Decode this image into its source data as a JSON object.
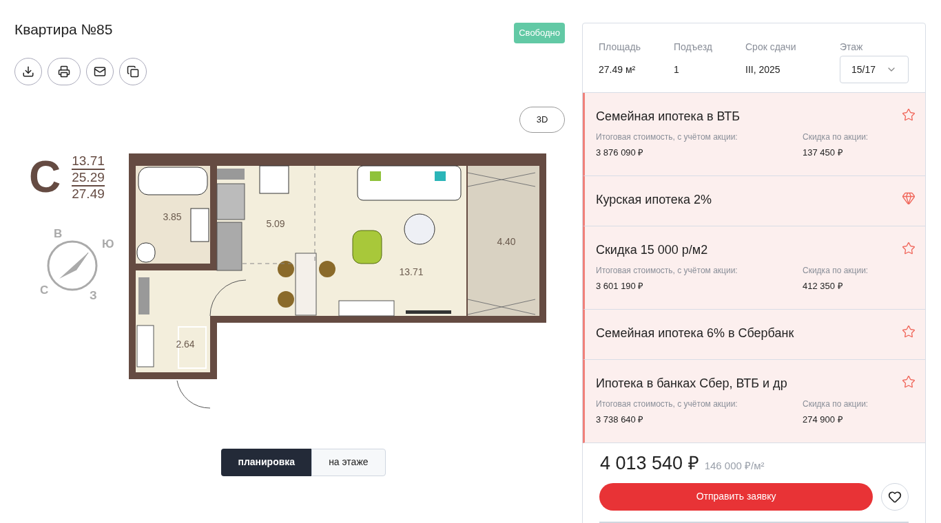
{
  "apartment": {
    "title": "Квартира №85",
    "status": "Свободно"
  },
  "view_3d_button": "3D",
  "legend": {
    "letter": "С",
    "areas": [
      "13.71",
      "25.29",
      "27.49"
    ]
  },
  "compass": {
    "labels": [
      "В",
      "Ю",
      "С",
      "З"
    ]
  },
  "plan": {
    "rooms": [
      {
        "label": "3.85"
      },
      {
        "label": "5.09"
      },
      {
        "label": "13.71"
      },
      {
        "label": "4.40"
      },
      {
        "label": "2.64"
      }
    ]
  },
  "view_tabs": [
    {
      "label": "планировка",
      "selected": true
    },
    {
      "label": "на этаже",
      "selected": false
    }
  ],
  "specs": [
    {
      "label": "Площадь",
      "value": "27.49 м²"
    },
    {
      "label": "Подъезд",
      "value": "1"
    },
    {
      "label": "Срок сдачи",
      "value": "III, 2025"
    }
  ],
  "floor": {
    "label": "Этаж",
    "value": "15/17"
  },
  "offers": [
    {
      "kind": "star",
      "title": "Семейная ипотека в ВТБ",
      "price_label": "Итоговая стоимость, с учётом акции:",
      "price": "3 876 090 ₽",
      "discount_label": "Скидка по акции:",
      "discount": "137 450 ₽"
    },
    {
      "kind": "gem",
      "title": "Курская ипотека 2%"
    },
    {
      "kind": "star",
      "title": "Скидка 15 000 р/м2",
      "price_label": "Итоговая стоимость, с учётом акции:",
      "price": "3 601 190 ₽",
      "discount_label": "Скидка по акции:",
      "discount": "412 350 ₽"
    },
    {
      "kind": "star",
      "title": "Семейная ипотека 6% в Сбербанк"
    },
    {
      "kind": "star",
      "title": "Ипотека в банках Сбер, ВТБ и др",
      "price_label": "Итоговая стоимость, с учётом акции:",
      "price": "3 738 640 ₽",
      "discount_label": "Скидка по акции:",
      "discount": "274 900 ₽"
    }
  ],
  "price": {
    "total": "4 013 540 ₽",
    "per_m2": "146 000 ₽/м²"
  },
  "submit_button": "Отправить заявку"
}
